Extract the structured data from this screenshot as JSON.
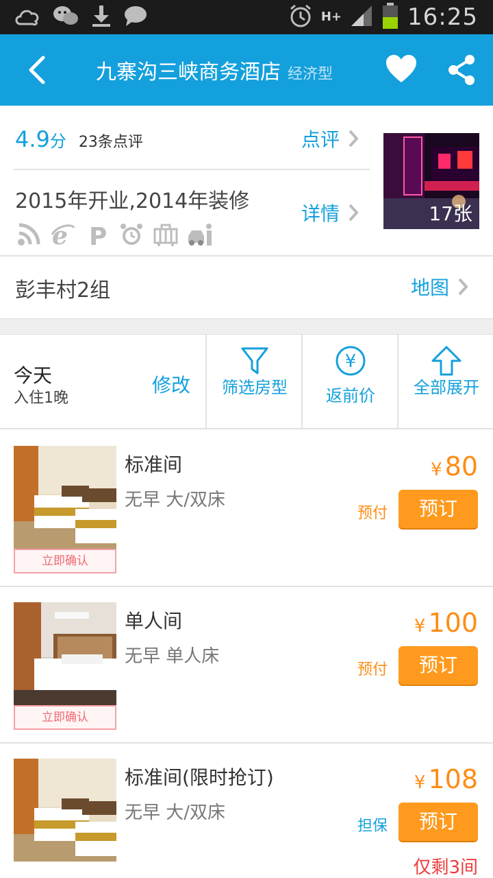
{
  "status_bar": {
    "time": "16:25",
    "network": "H+",
    "left_icons": [
      "cloud-icon",
      "wechat-icon",
      "download-icon",
      "message-icon"
    ],
    "right_icons": [
      "alarm-icon",
      "network-icon",
      "signal-icon",
      "battery-icon"
    ]
  },
  "header": {
    "title": "九寨沟三峡商务酒店",
    "tag": "经济型",
    "bg_color": "#14a0dc"
  },
  "info": {
    "score_value": "4.9",
    "score_unit": "分",
    "review_count": "23条点评",
    "review_link": "点评",
    "open_year": "2015年开业,2014年装修",
    "detail_link": "详情",
    "facility_icons": [
      "wifi-icon",
      "ie-icon",
      "parking-icon",
      "alarm-clock-icon",
      "luggage-icon",
      "pickup-icon"
    ],
    "photo_count": "17张",
    "address": "彭丰村2组",
    "map_link": "地图"
  },
  "filter": {
    "date_label": "今天",
    "nights_label": "入住1晚",
    "modify_label": "修改",
    "room_filter_label": "筛选房型",
    "cashback_label": "返前价",
    "expand_label": "全部展开"
  },
  "rooms": [
    {
      "name": "标准间",
      "desc": "无早 大/双床",
      "price": "80",
      "currency": "¥",
      "pay_type": "预付",
      "book_label": "预订",
      "confirm_label": "立即确认",
      "remain": ""
    },
    {
      "name": "单人间",
      "desc": "无早 单人床",
      "price": "100",
      "currency": "¥",
      "pay_type": "预付",
      "book_label": "预订",
      "confirm_label": "立即确认",
      "remain": ""
    },
    {
      "name": "标准间(限时抢订)",
      "desc": "无早 大/双床",
      "price": "108",
      "currency": "¥",
      "pay_type": "担保",
      "book_label": "预订",
      "confirm_label": "",
      "remain": "仅剩3间"
    }
  ],
  "colors": {
    "accent": "#14a0dc",
    "price": "#ff8c14",
    "book_button": "#ff9a1e",
    "alert": "#ee3b3b"
  }
}
